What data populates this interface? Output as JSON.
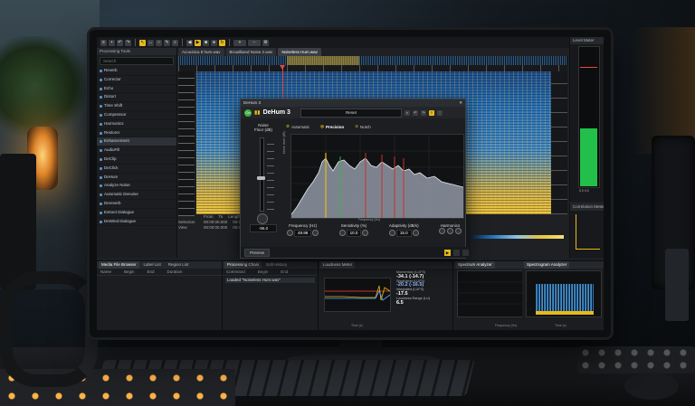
{
  "toolbar": {
    "button_icons": [
      "menu-icon",
      "save-icon",
      "undo-icon",
      "redo-icon",
      "cursor-icon",
      "time-select-icon",
      "lasso-icon",
      "brush-icon",
      "zoom-icon",
      "play-icon",
      "stop-icon",
      "record-icon",
      "loop-icon",
      "settings-icon"
    ]
  },
  "processing_tools": {
    "title": "Processing Tools",
    "search_placeholder": "Search",
    "modules": [
      "Reverb",
      "Corrector",
      "Echo",
      "Distort",
      "Time Shift",
      "Compressor",
      "Harmonics",
      "Restorer",
      "Enhancement",
      "AudioFill",
      "DeClip",
      "DeClick",
      "DeHum",
      "Analyze Noise",
      "Automatic Denoise",
      "Dereverb",
      "Extract Dialogue",
      "DeWind Dialogue"
    ],
    "selected_index": 8
  },
  "document_tabs": [
    {
      "label": "Acoustica 8 hum.wav",
      "active": false
    },
    {
      "label": "Broadband Noise 2.wav",
      "active": false
    },
    {
      "label": "Noiseless Hum.wav",
      "active": true
    }
  ],
  "selection_info": {
    "selection_label": "Selection",
    "selection_start": "00:00:00.000",
    "selection_end": "00:00:00.000",
    "view_label": "View",
    "view_start": "00:00:00.000",
    "view_end": "00:00:00.000",
    "from_label": "From",
    "to_label": "To",
    "length_label": "Length"
  },
  "dehum": {
    "window_title": "DeHum 3",
    "plugin_name": "DeHum 3",
    "power_label": "On",
    "preset": "Reset",
    "noise_floor": {
      "label_line1": "Noise",
      "label_line2": "Floor (dB)",
      "value": "-96.0"
    },
    "modes": [
      {
        "label": "Automatic",
        "active": false
      },
      {
        "label": "Precision",
        "active": true
      },
      {
        "label": "Notch",
        "active": false
      }
    ],
    "graph": {
      "ylabel": "Noise level (dB)",
      "xlabel": "Frequency (Hz)"
    },
    "params": [
      {
        "label": "Frequency (Hz)",
        "value": "49.98"
      },
      {
        "label": "Sensitivity (%)",
        "value": "10.0"
      },
      {
        "label": "Adaptivity (dB/s)",
        "value": "15.0"
      },
      {
        "label": "Harmonics",
        "value": ""
      }
    ],
    "preview_label": "Preview"
  },
  "level_meter": {
    "title": "Level Meter",
    "scale_label": "0.0  0.0",
    "level_fraction": 0.42,
    "peak_fraction": 0.86
  },
  "correlation_meter": {
    "title": "Correlation Meter"
  },
  "bottom_panels": {
    "media_browser": {
      "tabs": [
        {
          "label": "Media File Browser",
          "active": true
        },
        {
          "label": "Label List",
          "active": false
        },
        {
          "label": "Region List",
          "active": false
        }
      ],
      "columns": [
        "Name",
        "Begin",
        "End",
        "Duration"
      ]
    },
    "processing_chain": {
      "tabs": [
        {
          "label": "Processing Chain",
          "active": true
        },
        {
          "label": "Edit History",
          "active": false
        }
      ],
      "columns": [
        "Command",
        "Begin",
        "End"
      ],
      "history_rows": [
        "Loaded \"Noiseless Hum.wav\""
      ]
    },
    "loudness_meter": {
      "title": "Loudness Meter",
      "stats": [
        {
          "label": "Momentary (LUFS)",
          "value": "-34.1 (-14.7)"
        },
        {
          "label": "Short-term (LUFS)",
          "value": "-20.2 (-16.5)"
        },
        {
          "label": "Integrated (LUFS)",
          "value": "-17.5"
        },
        {
          "label": "Loudness Range (LU)",
          "value": "6.5"
        }
      ],
      "xlabel": "Time (s)"
    },
    "spectrum_analyzer": {
      "title": "Spectrum Analyzer",
      "xlabel": "Frequency (Hz)"
    },
    "spectrogram_analyzer": {
      "title": "Spectrogram Analyzer",
      "xlabel": "Time (s)"
    }
  }
}
